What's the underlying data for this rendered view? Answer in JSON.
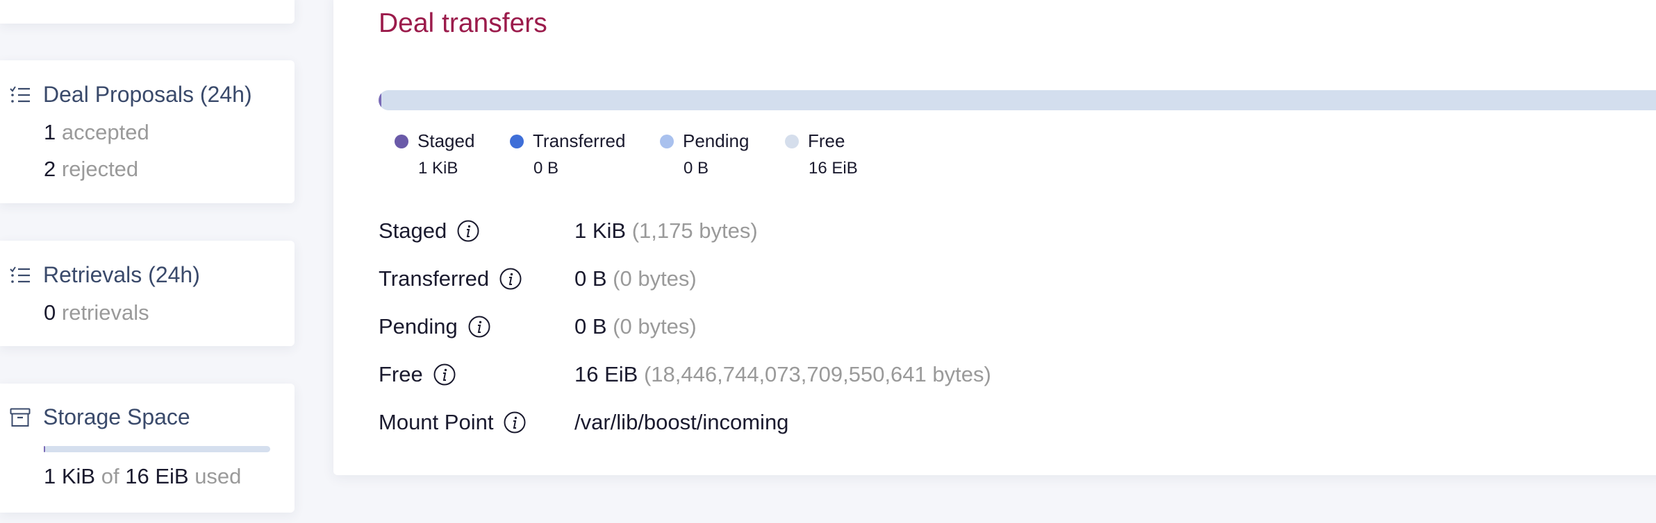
{
  "colors": {
    "accent_title": "#9b1b4b",
    "staged": "#6a5aa8",
    "transferred": "#3f6fd8",
    "pending": "#a9c1ee",
    "free": "#d5deec"
  },
  "sidebar": {
    "proposals": {
      "title": "Deal Proposals (24h)",
      "icon": "list-check-icon",
      "accepted_count": "1",
      "accepted_label": "accepted",
      "rejected_count": "2",
      "rejected_label": "rejected"
    },
    "retrievals": {
      "title": "Retrievals (24h)",
      "icon": "list-check-icon",
      "count": "0",
      "label": "retrievals"
    },
    "storage": {
      "title": "Storage Space",
      "icon": "archive-box-icon",
      "used": "1 KiB",
      "of_label": "of",
      "total": "16 EiB",
      "used_label": "used",
      "used_fraction": 0.005
    }
  },
  "main": {
    "title": "Deal transfers",
    "bar_fraction_staged": 0.002,
    "legend": [
      {
        "label": "Staged",
        "value": "1 KiB",
        "color": "#6a5aa8"
      },
      {
        "label": "Transferred",
        "value": "0 B",
        "color": "#3f6fd8"
      },
      {
        "label": "Pending",
        "value": "0 B",
        "color": "#a9c1ee"
      },
      {
        "label": "Free",
        "value": "16 EiB",
        "color": "#d5deec"
      }
    ],
    "details": [
      {
        "label": "Staged",
        "value": "1 KiB",
        "bytes": "(1,175 bytes)"
      },
      {
        "label": "Transferred",
        "value": "0 B",
        "bytes": "(0 bytes)"
      },
      {
        "label": "Pending",
        "value": "0 B",
        "bytes": "(0 bytes)"
      },
      {
        "label": "Free",
        "value": "16 EiB",
        "bytes": "(18,446,744,073,709,550,641 bytes)"
      },
      {
        "label": "Mount Point",
        "value": "/var/lib/boost/incoming",
        "bytes": ""
      }
    ]
  }
}
